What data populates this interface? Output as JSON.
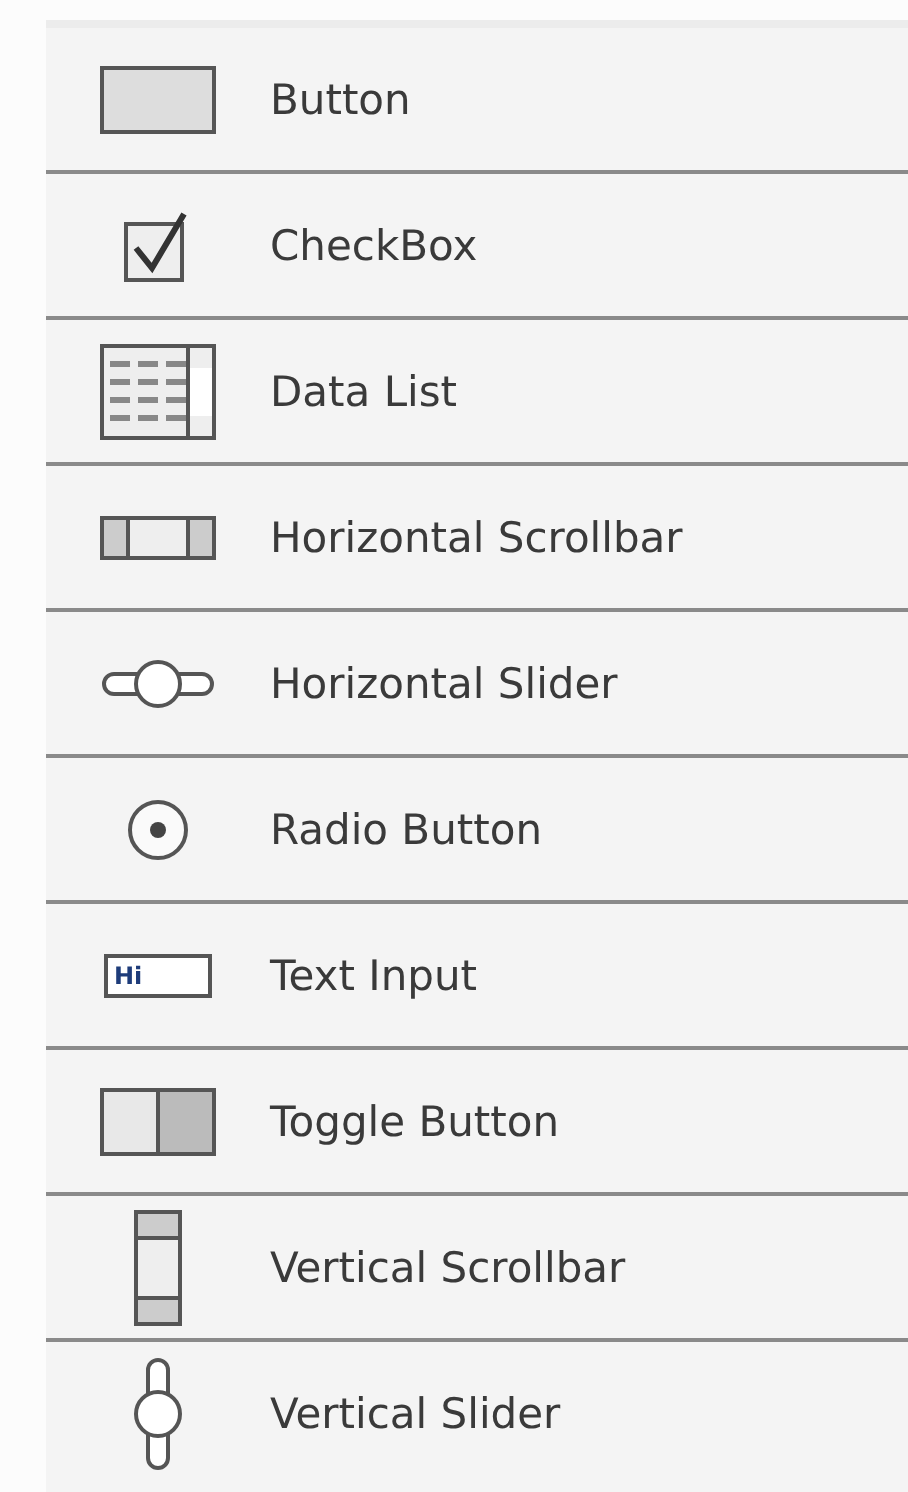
{
  "items": [
    {
      "kind": "button",
      "label": "Button"
    },
    {
      "kind": "checkbox",
      "label": "CheckBox"
    },
    {
      "kind": "datalist",
      "label": "Data List"
    },
    {
      "kind": "hscrollbar",
      "label": "Horizontal Scrollbar"
    },
    {
      "kind": "hslider",
      "label": "Horizontal Slider"
    },
    {
      "kind": "radio",
      "label": "Radio Button"
    },
    {
      "kind": "textinput",
      "label": "Text Input",
      "icon_text": "Hi"
    },
    {
      "kind": "toggle",
      "label": "Toggle Button"
    },
    {
      "kind": "vscrollbar",
      "label": "Vertical Scrollbar"
    },
    {
      "kind": "vslider",
      "label": "Vertical Slider"
    }
  ]
}
